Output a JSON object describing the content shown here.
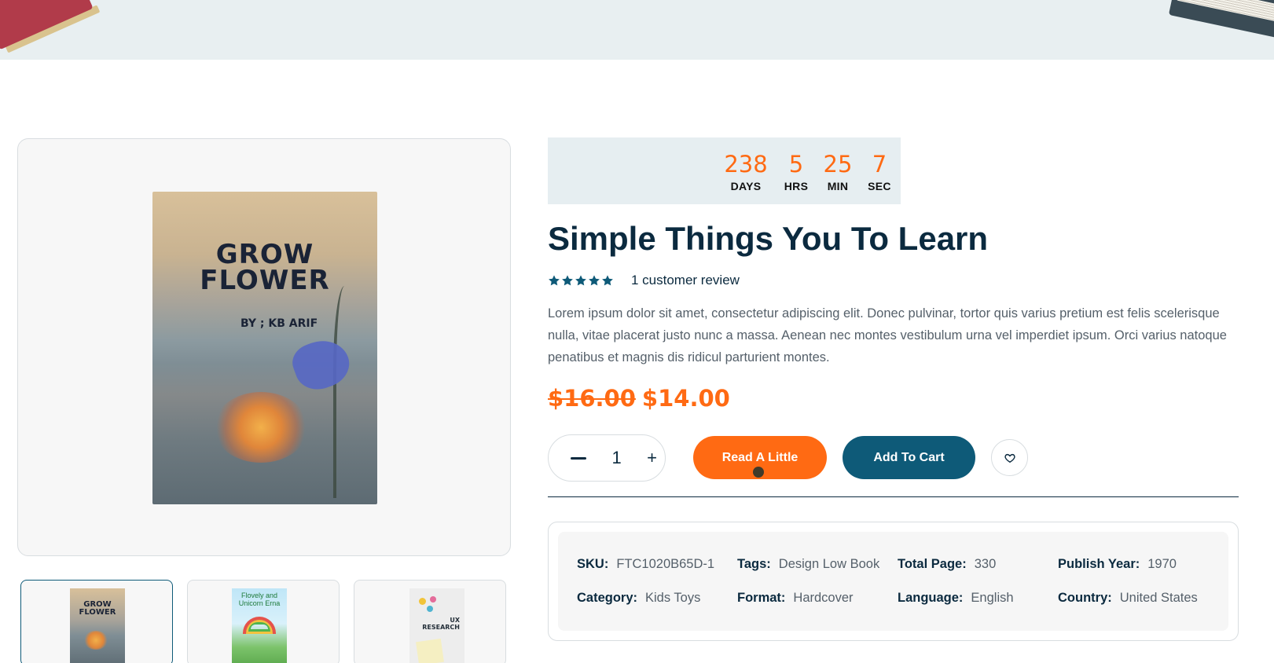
{
  "countdown": {
    "days": "238",
    "days_label": "DAYS",
    "hours": "5",
    "hours_label": "HRS",
    "minutes": "25",
    "minutes_label": "MIN",
    "seconds": "7",
    "seconds_label": "SEC"
  },
  "product": {
    "title": "Simple Things You To Learn",
    "rating": 5,
    "review_text": "1 customer review",
    "description": "Lorem ipsum dolor sit amet, consectetur adipiscing elit. Donec pulvinar, tortor quis varius pretium est felis scelerisque nulla, vitae placerat justo nunc a massa. Aenean nec montes vestibulum urna vel imperdiet ipsum. Orci varius natoque penatibus et magnis dis ridicul parturient montes.",
    "old_price": "$16.00",
    "new_price": "$14.00"
  },
  "cover": {
    "title": "GROW\nFLOWER",
    "author": "BY ; KB  ARIF"
  },
  "thumbnails": [
    {
      "title": "GROW\nFLOWER"
    },
    {
      "title": "Flovely and\nUnicorn Erna"
    },
    {
      "title": "UX\nRESEARCH"
    }
  ],
  "actions": {
    "quantity": "1",
    "minus": "−",
    "plus": "+",
    "read_label": "Read A Little",
    "cart_label": "Add To Cart"
  },
  "meta": {
    "sku_key": "SKU:",
    "sku_val": "FTC1020B65D-1",
    "tags_key": "Tags:",
    "tags_val": "Design Low Book",
    "pages_key": "Total Page:",
    "pages_val": "330",
    "year_key": "Publish Year:",
    "year_val": "1970",
    "category_key": "Category:",
    "category_val": "Kids Toys",
    "format_key": "Format:",
    "format_val": "Hardcover",
    "language_key": "Language:",
    "language_val": "English",
    "country_key": "Country:",
    "country_val": "United States"
  },
  "colors": {
    "accent_orange": "#ff6a13",
    "primary_teal": "#0e5a78",
    "heading_navy": "#0b2a3f",
    "star_color": "#0e5a78"
  },
  "icons": {
    "star": "star-icon",
    "wishlist": "heart-icon"
  }
}
